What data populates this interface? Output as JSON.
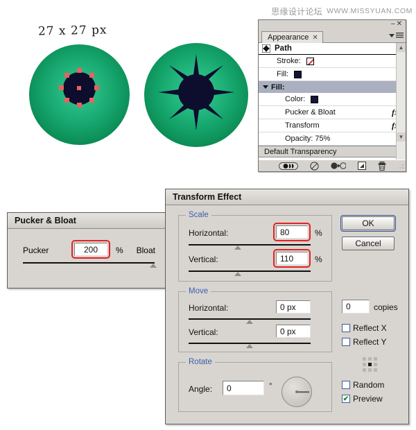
{
  "watermark": {
    "cn_text": "思缘设计论坛",
    "url_text": "WWW.MISSYUAN.COM"
  },
  "artwork": {
    "size_label": "27 x 27 px",
    "sphere_a_name": "green-eye-with-anchor-points",
    "sphere_b_name": "green-eye-with-pucker-star",
    "green_edge_color": "#07703f",
    "green_center_color": "#35c890",
    "pupil_color": "#0d0d2e",
    "anchor_point_color": "#e8635f"
  },
  "appearance_panel": {
    "tab_label": "Appearance",
    "tab_close": "✕",
    "minimize": "–",
    "close": "✕",
    "menu_icon": "panel-menu-icon",
    "target_label": "Path",
    "rows": [
      {
        "label": "Stroke:",
        "swatch": "none"
      },
      {
        "label": "Fill:",
        "swatch": "navy"
      }
    ],
    "fill_group_label": "Fill:",
    "fill_rows": [
      {
        "label": "Color:",
        "swatch": "navy",
        "fx": ""
      },
      {
        "label": "Pucker & Bloat",
        "swatch": "",
        "fx": "fx"
      },
      {
        "label": "Transform",
        "swatch": "",
        "fx": "fx"
      },
      {
        "label": "Opacity: 75%",
        "swatch": "",
        "fx": ""
      }
    ],
    "footer_label": "Default Transparency",
    "footer_icons": [
      "toggle-visibility-icon",
      "clear-appearance-icon",
      "reduce-to-basic-appearance-icon",
      "duplicate-item-icon",
      "delete-item-icon"
    ],
    "scroll_up": "▲",
    "scroll_down": "▼"
  },
  "pucker_dialog": {
    "title": "Pucker & Bloat",
    "left_label": "Pucker",
    "right_label": "Bloat",
    "percent_symbol": "%",
    "value": "200",
    "slider_position_pct": 97
  },
  "transform_dialog": {
    "title": "Transform Effect",
    "scale": {
      "legend": "Scale",
      "horizontal_label": "Horizontal:",
      "horizontal_value": "80",
      "horizontal_unit": "%",
      "horizontal_slider_pct": 40,
      "vertical_label": "Vertical:",
      "vertical_value": "110",
      "vertical_unit": "%",
      "vertical_slider_pct": 40
    },
    "move": {
      "legend": "Move",
      "horizontal_label": "Horizontal:",
      "horizontal_value": "0 px",
      "horizontal_slider_pct": 50,
      "vertical_label": "Vertical:",
      "vertical_value": "0 px",
      "vertical_slider_pct": 50
    },
    "rotate": {
      "legend": "Rotate",
      "angle_label": "Angle:",
      "angle_value": "0",
      "degree_symbol": "°",
      "dial_name": "rotate-dial"
    },
    "ok_label": "OK",
    "cancel_label": "Cancel",
    "copies_value": "0",
    "copies_label": "copies",
    "reflect_x_label": "Reflect X",
    "reflect_x_checked": false,
    "reflect_y_label": "Reflect Y",
    "reflect_y_checked": false,
    "random_label": "Random",
    "random_checked": false,
    "preview_label": "Preview",
    "preview_checked": true,
    "preview_check_glyph": "✔",
    "anchor_grid_name": "reference-point-grid",
    "anchor_selected": "center"
  },
  "colors": {
    "dialog_bg": "#d8d5d0",
    "highlight_red": "#e52222",
    "legend_blue": "#3a5fb0",
    "fill_header_bg": "#aab0c0"
  }
}
